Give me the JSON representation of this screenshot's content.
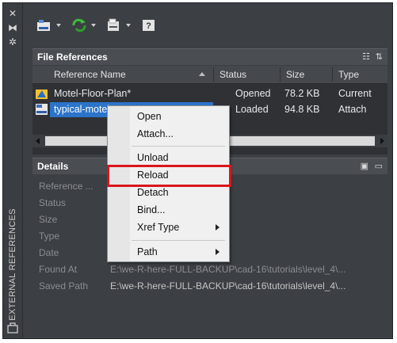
{
  "palette": {
    "selection": "#2b74c9",
    "highlight": "#d9161c",
    "panel": "#3c3f43"
  },
  "strip": {
    "icons": [
      "close-icon",
      "pin-icon",
      "settings-icon"
    ],
    "title": "EXTERNAL REFERENCES"
  },
  "toolbar": {
    "icons": [
      "attach-dwg-icon",
      "refresh-icon",
      "change-path-icon",
      "help-icon"
    ]
  },
  "file_references": {
    "title": "File References",
    "columns": [
      "Reference Name",
      "Status",
      "Size",
      "Type"
    ],
    "rows": [
      {
        "name": "Motel-Floor-Plan*",
        "status": "Opened",
        "size": "78.2 KB",
        "type": "Current",
        "icon": "dwg-master-icon"
      },
      {
        "name": "typical-motel-room",
        "status": "Loaded",
        "size": "94.8 KB",
        "type": "Attach",
        "icon": "dwg-xref-icon"
      }
    ]
  },
  "details": {
    "title": "Details",
    "labels": [
      "Reference ...",
      "Status",
      "Size",
      "Type",
      "Date",
      "Found At",
      "Saved Path"
    ],
    "found_at": "E:\\we-R-here-FULL-BACKUP\\cad-16\\tutorials\\level_4\\...",
    "saved_path": "E:\\we-R-here-FULL-BACKUP\\cad-16\\tutorials\\level_4\\..."
  },
  "context_menu": {
    "items": [
      {
        "label": "Open",
        "submenu": false
      },
      {
        "label": "Attach...",
        "submenu": false
      },
      {
        "label": "Unload",
        "submenu": false
      },
      {
        "label": "Reload",
        "submenu": false,
        "highlighted": true
      },
      {
        "label": "Detach",
        "submenu": false
      },
      {
        "label": "Bind...",
        "submenu": false
      },
      {
        "label": "Xref Type",
        "submenu": true
      },
      {
        "label": "Path",
        "submenu": true
      }
    ]
  }
}
